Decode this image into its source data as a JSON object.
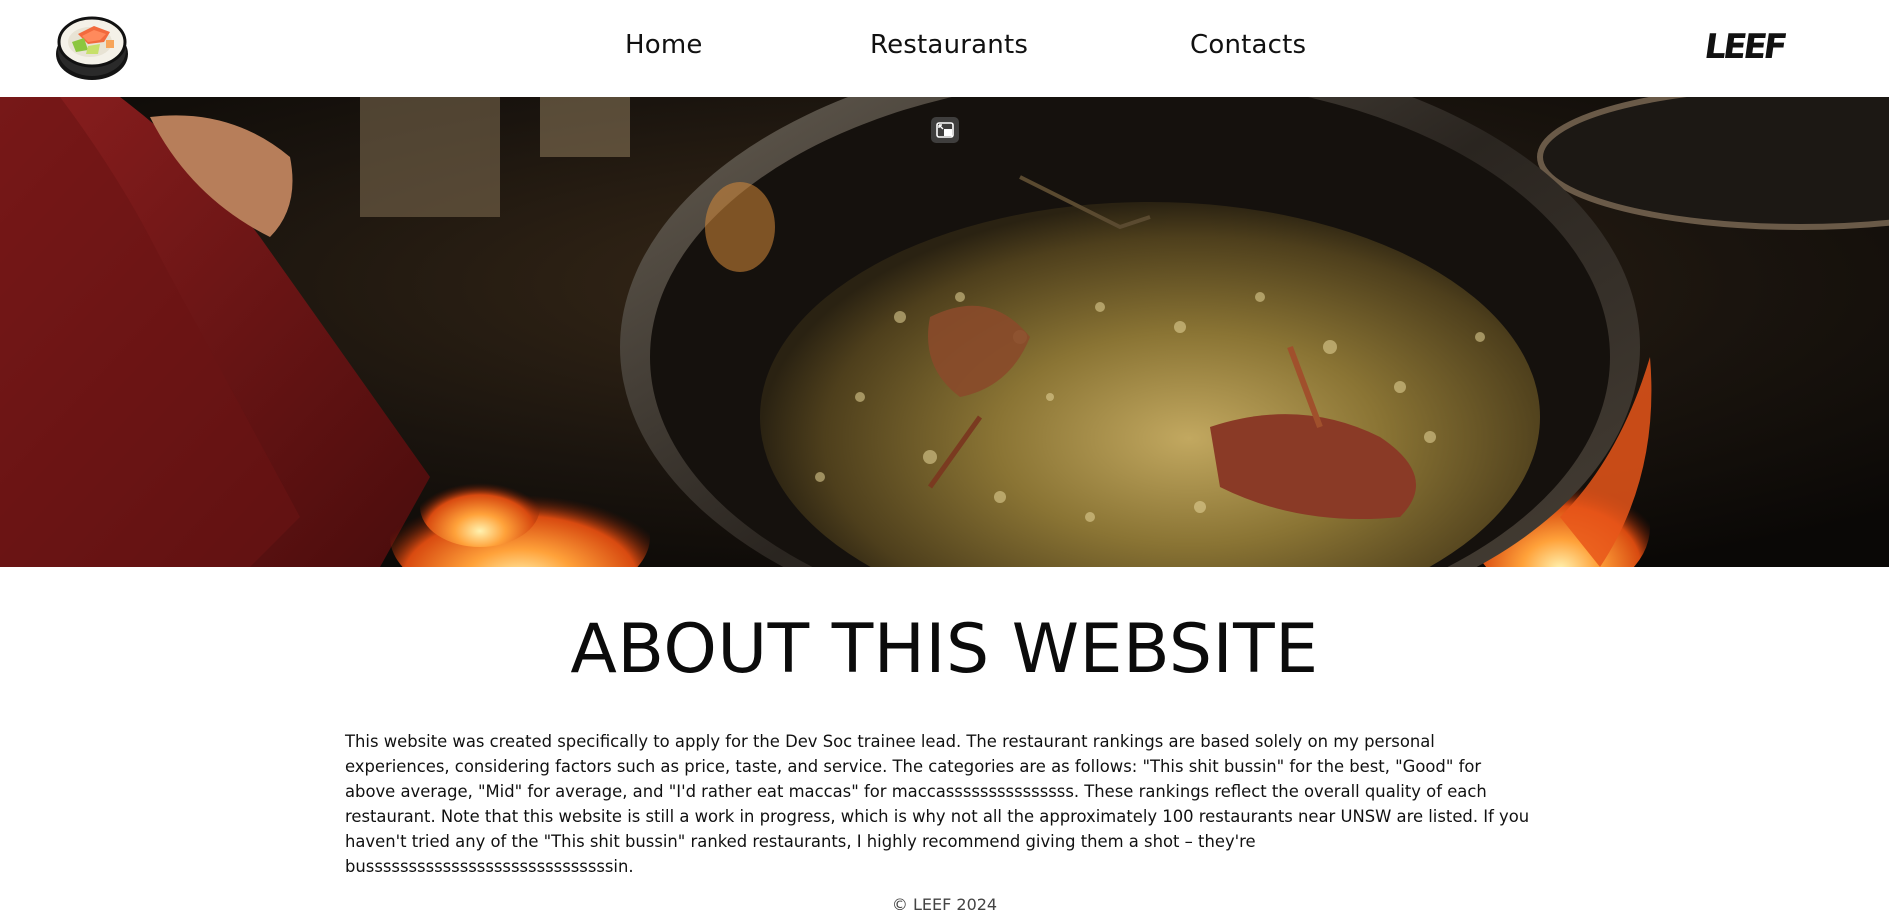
{
  "nav": {
    "logo_icon": "sushi-roll-icon",
    "links": [
      {
        "label": "Home"
      },
      {
        "label": "Restaurants"
      },
      {
        "label": "Contacts"
      }
    ],
    "brand_text": "LEEF"
  },
  "hero": {
    "pip_icon": "picture-in-picture-icon"
  },
  "about": {
    "title": "ABOUT THIS WEBSITE",
    "body": "This website was created specifically to apply for the Dev Soc trainee lead. The restaurant rankings are based solely on my personal experiences, considering factors such as price, taste, and service. The categories are as follows: \"This shit bussin\" for the best, \"Good\" for above average, \"Mid\" for average, and \"I'd rather eat maccas\" for maccasssssssssssssss. These rankings reflect the overall quality of each restaurant. Note that this website is still a work in progress, which is why not all the approximately 100 restaurants near UNSW are listed. If you haven't tried any of the \"This shit bussin\" ranked restaurants, I highly recommend giving them a shot – they're busssssssssssssssssssssssssssssin."
  },
  "footer": {
    "text": "© LEEF 2024"
  },
  "colors": {
    "background": "#ffffff",
    "text": "#111111",
    "footer_text": "#444444"
  }
}
